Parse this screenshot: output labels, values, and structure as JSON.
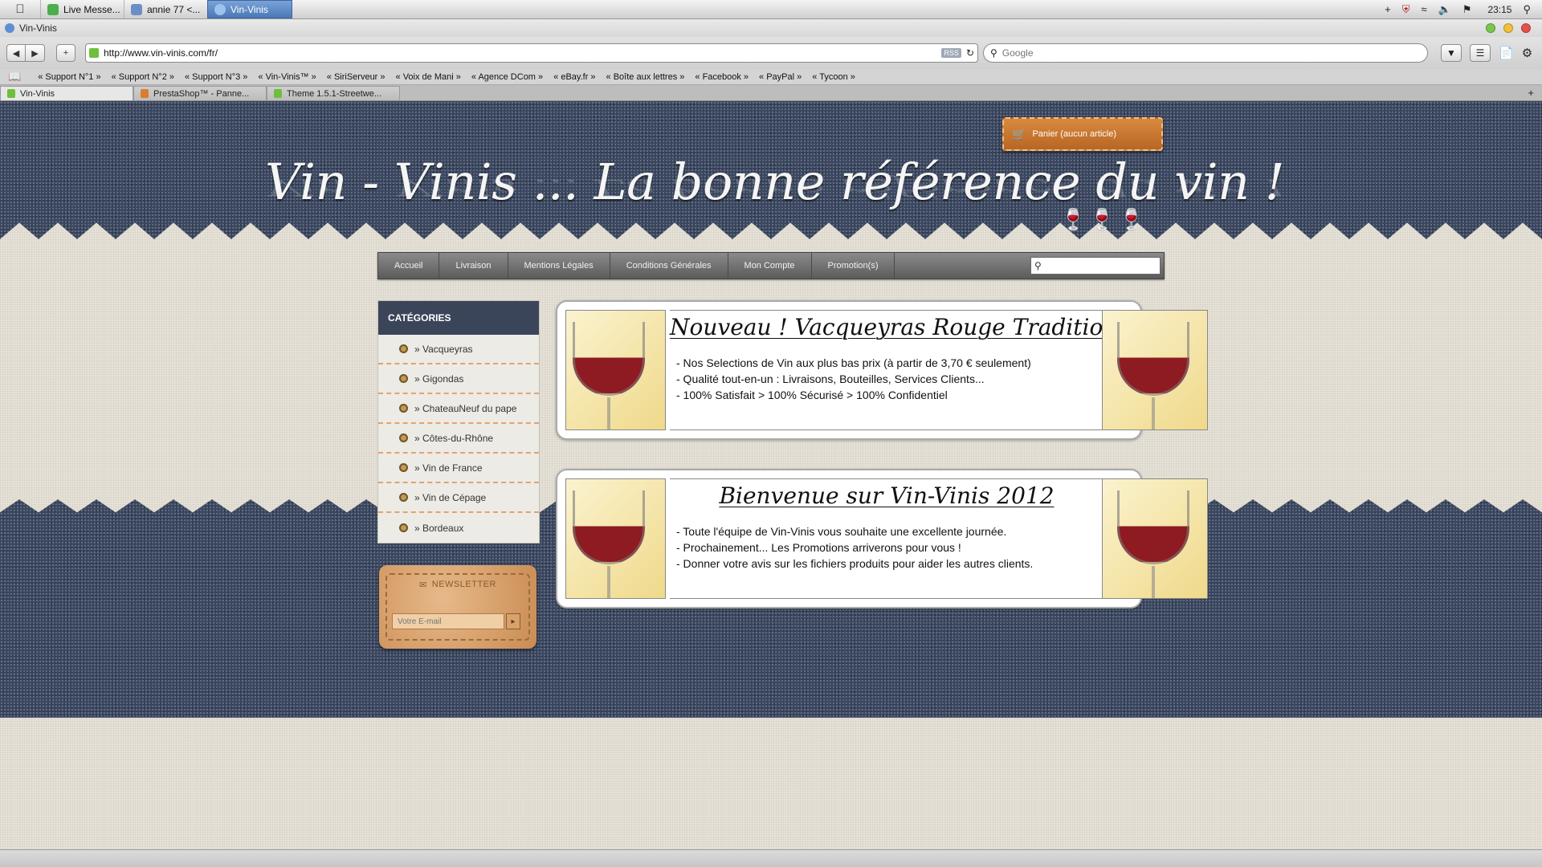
{
  "os_menubar": {
    "tasks": [
      {
        "label": "Live Messe...",
        "active": false
      },
      {
        "label": "annie 77 <...",
        "active": false
      },
      {
        "label": "Vin-Vinis",
        "active": true
      }
    ],
    "clock": "23:15"
  },
  "browser": {
    "window_title": "Vin-Vinis",
    "url": "http://www.vin-vinis.com/fr/",
    "rss_label": "RSS",
    "search_placeholder": "Google",
    "bookmarks": [
      "« Support N°1 »",
      "« Support N°2 »",
      "« Support N°3 »",
      "« Vin-Vinis™ »",
      "« SiriServeur »",
      "« Voix de Mani »",
      "« Agence DCom »",
      "« eBay.fr »",
      "« Boîte aux lettres »",
      "« Facebook »",
      "« PayPal »",
      "« Tycoon »"
    ],
    "tabs": [
      {
        "label": "Vin-Vinis",
        "active": true
      },
      {
        "label": "PrestaShop™ - Panne...",
        "active": false
      },
      {
        "label": "Theme 1.5.1-Streetwe...",
        "active": false
      }
    ],
    "new_tab": "+"
  },
  "site": {
    "cart_label": "Panier (aucun article)",
    "title": "Vin - Vinis ... La bonne référence du vin !",
    "nav": [
      "Accueil",
      "Livraison",
      "Mentions Légales",
      "Conditions Générales",
      "Mon Compte",
      "Promotion(s)"
    ],
    "search_icon": "magnifier-icon",
    "categories_title": "CATÉGORIES",
    "categories": [
      "» Vacqueyras",
      "» Gigondas",
      "» ChateauNeuf du pape",
      "» Côtes-du-Rhône",
      "» Vin de France",
      "» Vin de Cépage",
      "» Bordeaux"
    ],
    "newsletter_title": "NEWSLETTER",
    "newsletter_placeholder": "Votre E-mail",
    "newsletter_submit": "▸",
    "banners": [
      {
        "title": "Nouveau ! Vacqueyras Rouge Tradition",
        "lines": [
          "- Nos Selections de Vin aux plus bas prix (à partir de 3,70 € seulement)",
          "- Qualité tout-en-un : Livraisons, Bouteilles, Services Clients...",
          "- 100% Satisfait > 100% Sécurisé > 100% Confidentiel"
        ]
      },
      {
        "title": "Bienvenue sur Vin-Vinis 2012",
        "lines": [
          "- Toute l'équipe de Vin-Vinis vous souhaite une excellente journée.",
          "- Prochainement... Les Promotions arriverons pour vous !",
          "- Donner votre avis sur les fichiers produits pour aider les autres clients."
        ]
      }
    ]
  },
  "colors": {
    "denim": "#38455f",
    "category_header": "#3b4559",
    "cart_orange": "#c9773a",
    "dashed_orange": "#e3a36b"
  }
}
